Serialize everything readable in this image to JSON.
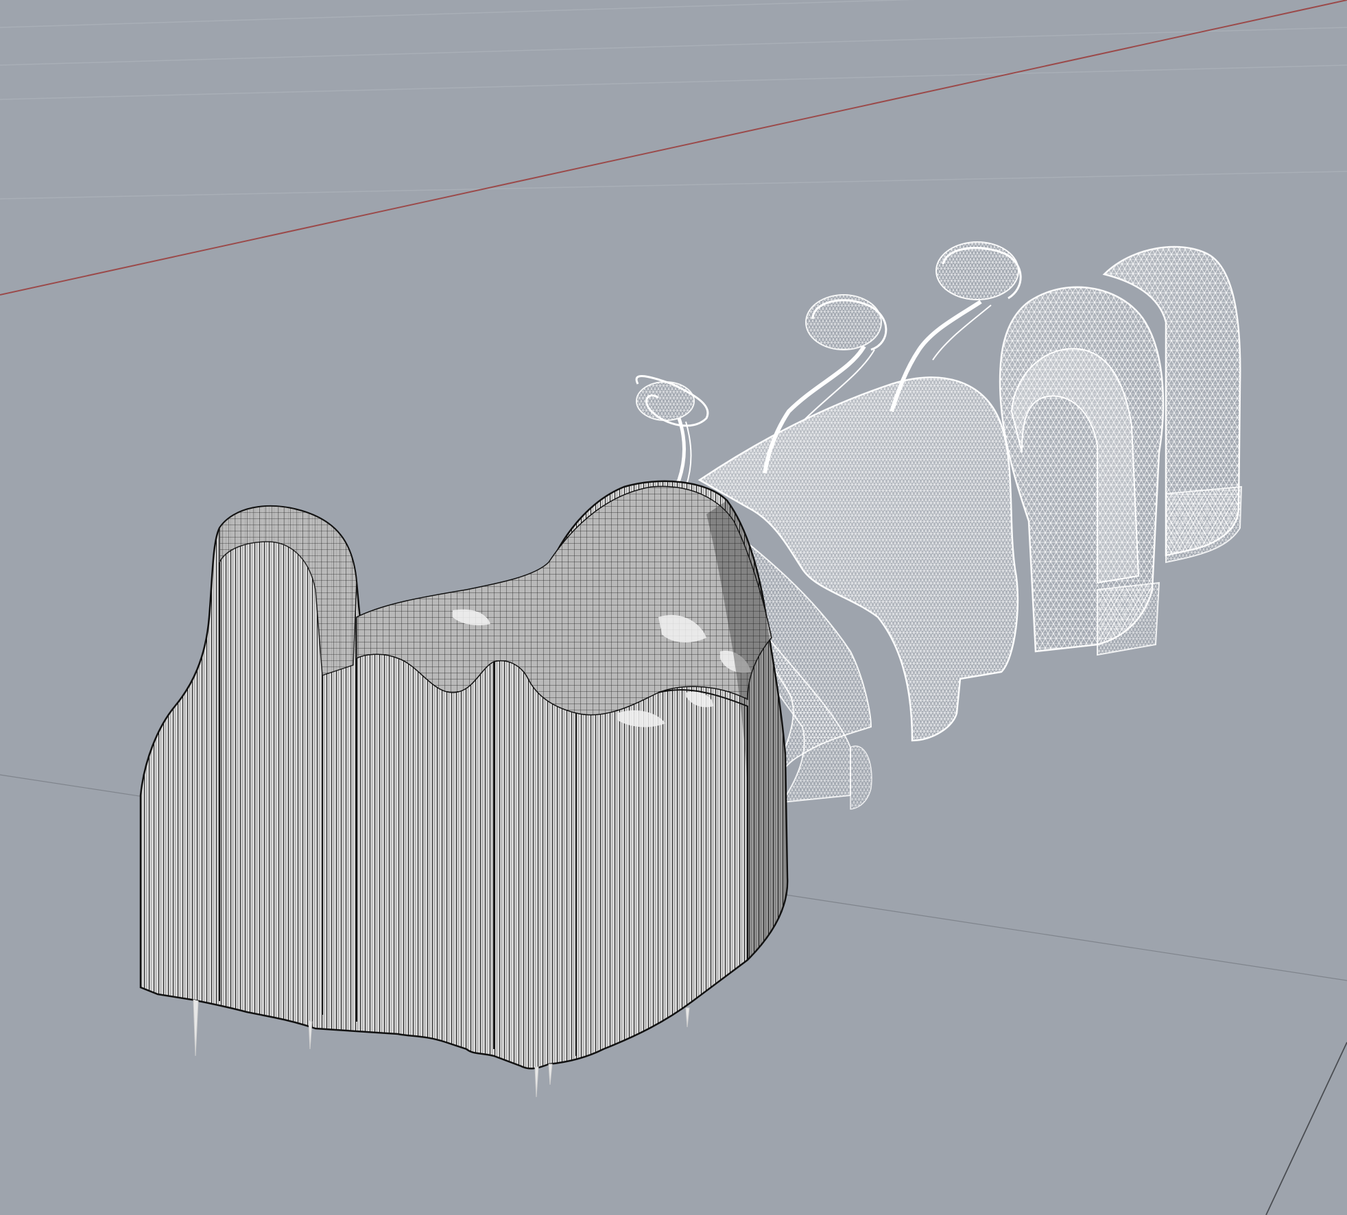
{
  "viewport": {
    "background": "#9ea4ad",
    "grid_minor_color": "#a9afb7",
    "grid_major_color": "#4a4d52",
    "x_axis_color": "#9b4a4a",
    "solid_object": {
      "type": "mesh-sofa",
      "display_mode": "shaded-with-isocurves",
      "fill": "#d0d0d0",
      "line_color": "#1a1a1a"
    },
    "wireframe_object": {
      "type": "mesh-sculpture",
      "display_mode": "wireframe",
      "line_color": "#ffffff"
    }
  }
}
